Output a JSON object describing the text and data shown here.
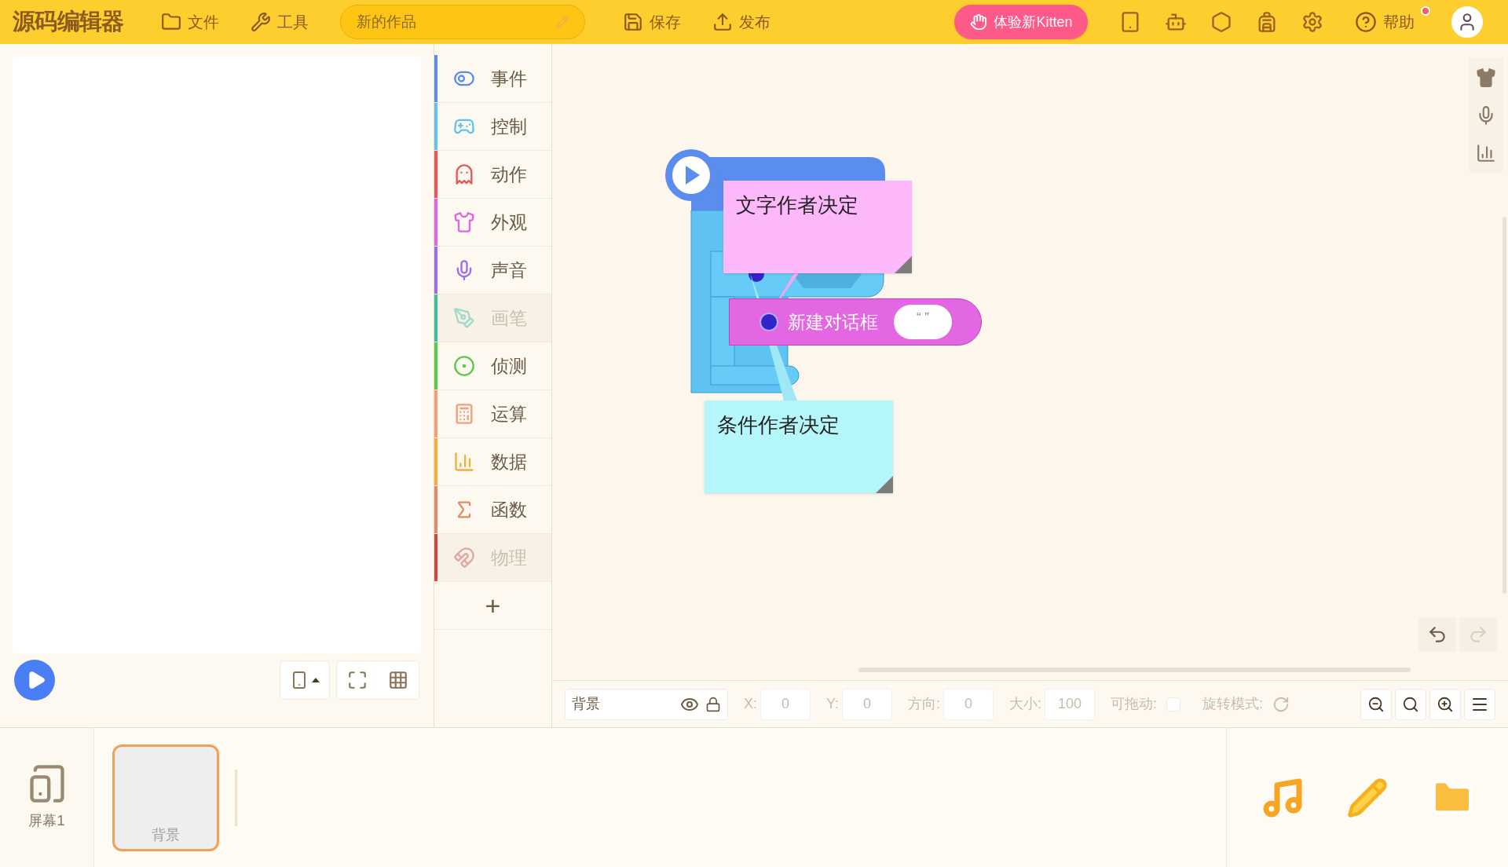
{
  "topbar": {
    "logo": "源码编辑器",
    "menus": [
      "文件",
      "工具"
    ],
    "project_title": "新的作品",
    "actions": [
      "保存",
      "发布"
    ],
    "promo_button": "体验新Kitten",
    "help": {
      "label": "帮助",
      "notification": true
    }
  },
  "categories": [
    {
      "label": "事件",
      "color": "#5b8def",
      "disabled": false
    },
    {
      "label": "控制",
      "color": "#5ec3f3",
      "disabled": false
    },
    {
      "label": "动作",
      "color": "#e5575a",
      "disabled": false
    },
    {
      "label": "外观",
      "color": "#e066e0",
      "disabled": false
    },
    {
      "label": "声音",
      "color": "#9a6cf0",
      "disabled": false
    },
    {
      "label": "画笔",
      "color": "#3bbfa3",
      "disabled": true
    },
    {
      "label": "侦测",
      "color": "#5cc94a",
      "disabled": false
    },
    {
      "label": "运算",
      "color": "#f0a07c",
      "disabled": false
    },
    {
      "label": "数据",
      "color": "#f3ad3b",
      "disabled": false
    },
    {
      "label": "函数",
      "color": "#e58a66",
      "disabled": false
    },
    {
      "label": "物理",
      "color": "#c94a4a",
      "disabled": true
    }
  ],
  "add_category": "+",
  "blocks": {
    "dialog": "新建对话框",
    "dialog_input": "“ ”"
  },
  "comments": [
    {
      "text": "文字作者决定",
      "kind": "pink"
    },
    {
      "text": "条件作者决定",
      "kind": "cyan"
    }
  ],
  "properties": {
    "sprite_name": "背景",
    "fields": [
      {
        "label": "X:",
        "value": "0"
      },
      {
        "label": "Y:",
        "value": "0"
      },
      {
        "label": "方向:",
        "value": "0"
      },
      {
        "label": "大小:",
        "value": "100"
      }
    ],
    "draggable_label": "可拖动:",
    "draggable": false,
    "rotation_label": "旋转模式:"
  },
  "screens": [
    {
      "label": "屏幕1"
    }
  ],
  "sprites": [
    {
      "label": "背景",
      "selected": true
    }
  ]
}
